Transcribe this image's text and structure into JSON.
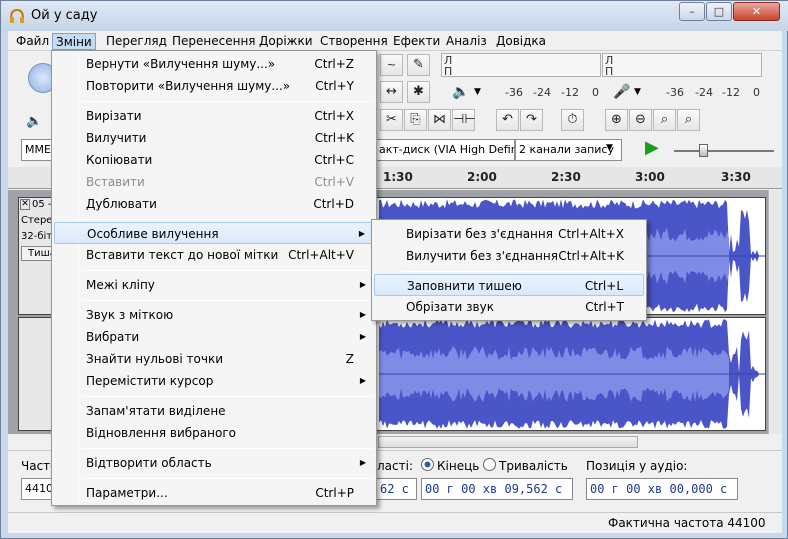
{
  "window": {
    "title": "Ой у саду",
    "minimize": "–",
    "maximize": "□",
    "close": "✕"
  },
  "menubar": [
    "Файл",
    "Зміни",
    "Перегляд",
    "Перенесення",
    "Доріжки",
    "Створення",
    "Ефекти",
    "Аналіз",
    "Довідка"
  ],
  "edit_menu": {
    "undo": {
      "label": "Вернути «Вилучення шуму...»",
      "shortcut": "Ctrl+Z"
    },
    "redo": {
      "label": "Повторити «Вилучення шуму...»",
      "shortcut": "Ctrl+Y"
    },
    "cut": {
      "label": "Вирізати",
      "shortcut": "Ctrl+X"
    },
    "delete": {
      "label": "Вилучити",
      "shortcut": "Ctrl+K"
    },
    "copy": {
      "label": "Копіювати",
      "shortcut": "Ctrl+C"
    },
    "paste": {
      "label": "Вставити",
      "shortcut": "Ctrl+V"
    },
    "duplicate": {
      "label": "Дублювати",
      "shortcut": "Ctrl+D"
    },
    "special_remove": {
      "label": "Особливе вилучення"
    },
    "paste_new_label": {
      "label": "Вставити текст до нової мітки",
      "shortcut": "Ctrl+Alt+V"
    },
    "clip_boundaries": {
      "label": "Межі кліпу"
    },
    "labeled_audio": {
      "label": "Звук з міткою"
    },
    "select": {
      "label": "Вибрати"
    },
    "find_zero": {
      "label": "Знайти нульові точки",
      "shortcut": "Z"
    },
    "move_cursor": {
      "label": "Перемістити курсор"
    },
    "store_selection": {
      "label": "Запам'ятати виділене"
    },
    "retrieve_selection": {
      "label": "Відновлення вибраного"
    },
    "play_region": {
      "label": "Відтворити область"
    },
    "preferences": {
      "label": "Параметри...",
      "shortcut": "Ctrl+P"
    }
  },
  "submenu": {
    "split_cut": {
      "label": "Вирізати без з'єднання",
      "shortcut": "Ctrl+Alt+X"
    },
    "split_delete": {
      "label": "Вилучити без з'єднання",
      "shortcut": "Ctrl+Alt+K"
    },
    "silence": {
      "label": "Заповнити тишею",
      "shortcut": "Ctrl+L"
    },
    "trim": {
      "label": "Обрізати звук",
      "shortcut": "Ctrl+T"
    }
  },
  "meters": {
    "play_l": "Л",
    "play_r": "П",
    "rec_l": "Л",
    "rec_r": "П",
    "ticks": [
      "-36",
      "-24",
      "-12",
      "0"
    ]
  },
  "devices": {
    "host": "MME",
    "input": "акт-диск (VIA High Defir",
    "channels": "2 канали запису"
  },
  "ruler": [
    "1:30",
    "2:00",
    "2:30",
    "3:00",
    "3:30"
  ],
  "track": {
    "name": "05 -",
    "line1": "Стерес",
    "line2": "32-біто",
    "mute": "Тиша"
  },
  "selection": {
    "rate_label": "Часто",
    "rate_value": "4410",
    "sel_label_tail": "ласті:",
    "end_radio": "Кінець",
    "length_radio": "Тривалість",
    "end_time_tail": "62 с",
    "end_time": "00 г 00 хв 09,562 с",
    "position_label": "Позиція у аудіо:",
    "position_time": "00 г 00 хв 00,000 с"
  },
  "status": {
    "actual_rate": "Фактична частота 44100"
  },
  "colors": {
    "waveform": "#4a55c8",
    "waveform_light": "#7f8ce6",
    "menu_highlight": "#d9e9fb"
  }
}
